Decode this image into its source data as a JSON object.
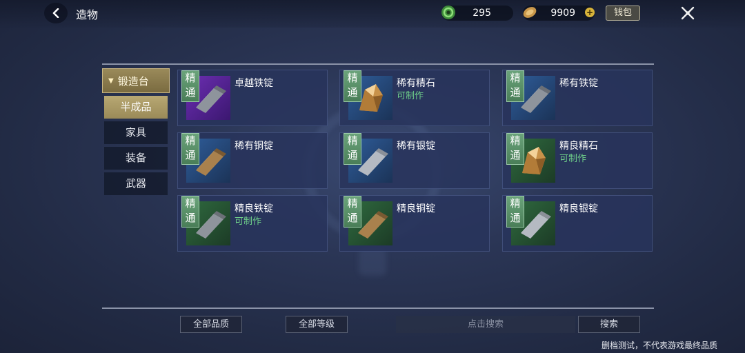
{
  "header": {
    "title": "造物",
    "currency_1_value": "295",
    "currency_2_value": "9909",
    "wallet_label": "钱包"
  },
  "nav": {
    "category": "锻造台",
    "items": [
      {
        "label": "半成品",
        "active": true
      },
      {
        "label": "家具",
        "active": false
      },
      {
        "label": "装备",
        "active": false
      },
      {
        "label": "武器",
        "active": false
      }
    ]
  },
  "items": [
    {
      "badge_top": "精",
      "badge_bottom": "通",
      "name": "卓越铁锭",
      "status": "",
      "thumb_color": "purple",
      "icon": "iron-ingot-icon"
    },
    {
      "badge_top": "精",
      "badge_bottom": "通",
      "name": "稀有精石",
      "status": "可制作",
      "thumb_color": "blue",
      "icon": "ore-crystal-icon"
    },
    {
      "badge_top": "精",
      "badge_bottom": "通",
      "name": "稀有铁锭",
      "status": "",
      "thumb_color": "blue",
      "icon": "iron-ingot-icon"
    },
    {
      "badge_top": "精",
      "badge_bottom": "通",
      "name": "稀有铜锭",
      "status": "",
      "thumb_color": "blue",
      "icon": "copper-ingot-icon"
    },
    {
      "badge_top": "精",
      "badge_bottom": "通",
      "name": "稀有银锭",
      "status": "",
      "thumb_color": "blue",
      "icon": "silver-ingot-icon"
    },
    {
      "badge_top": "精",
      "badge_bottom": "通",
      "name": "精良精石",
      "status": "可制作",
      "thumb_color": "green",
      "icon": "ore-crystal-icon"
    },
    {
      "badge_top": "精",
      "badge_bottom": "通",
      "name": "精良铁锭",
      "status": "可制作",
      "thumb_color": "green",
      "icon": "iron-ingot-icon"
    },
    {
      "badge_top": "精",
      "badge_bottom": "通",
      "name": "精良铜锭",
      "status": "",
      "thumb_color": "green",
      "icon": "copper-ingot-icon"
    },
    {
      "badge_top": "精",
      "badge_bottom": "通",
      "name": "精良银锭",
      "status": "",
      "thumb_color": "green",
      "icon": "silver-ingot-icon"
    }
  ],
  "filters": {
    "quality_label": "全部品质",
    "level_label": "全部等级",
    "search_placeholder": "点击搜索",
    "search_button": "搜索"
  },
  "footer": {
    "disclaimer": "删档测试，不代表游戏最终品质"
  },
  "colors": {
    "craftable_green": "#6fd08a",
    "accent_gold": "#b8a873",
    "badge_green": "#6aa37a"
  }
}
